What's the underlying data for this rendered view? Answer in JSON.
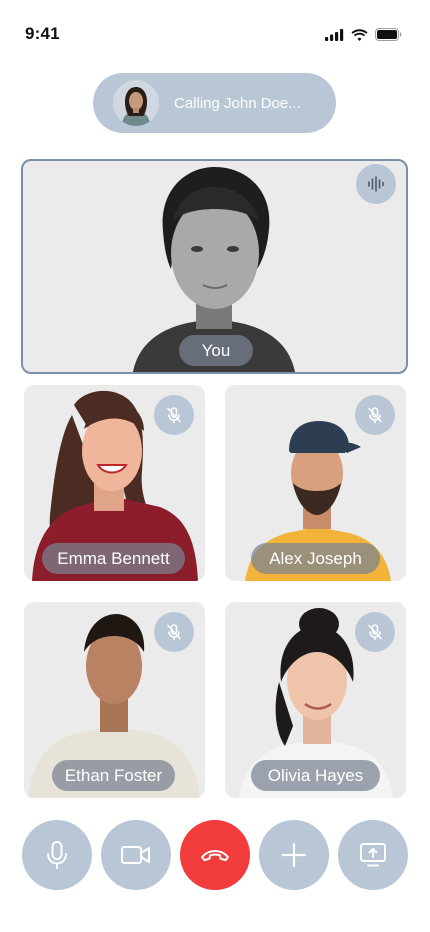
{
  "status_bar": {
    "time": "9:41"
  },
  "call": {
    "status_text": "Calling John Doe..."
  },
  "participants": [
    {
      "name": "You",
      "indicator": "audio-wave-icon"
    },
    {
      "name": "Emma Bennett",
      "indicator": "mic-off-icon"
    },
    {
      "name": "Alex Joseph",
      "indicator": "mic-off-icon"
    },
    {
      "name": "Ethan Foster",
      "indicator": "mic-off-icon"
    },
    {
      "name": "Olivia Hayes",
      "indicator": "mic-off-icon"
    }
  ],
  "controls": [
    {
      "name": "microphone",
      "icon": "mic-icon"
    },
    {
      "name": "camera",
      "icon": "video-camera-icon"
    },
    {
      "name": "end-call",
      "icon": "phone-hangup-icon",
      "color": "#f23b3b"
    },
    {
      "name": "add-participant",
      "icon": "plus-icon"
    },
    {
      "name": "share-screen",
      "icon": "screen-share-icon"
    }
  ],
  "colors": {
    "accent": "#b9c6d5",
    "end_call": "#f23b3b",
    "active_border": "#7b90a8",
    "tile_bg": "#ebebeb"
  }
}
